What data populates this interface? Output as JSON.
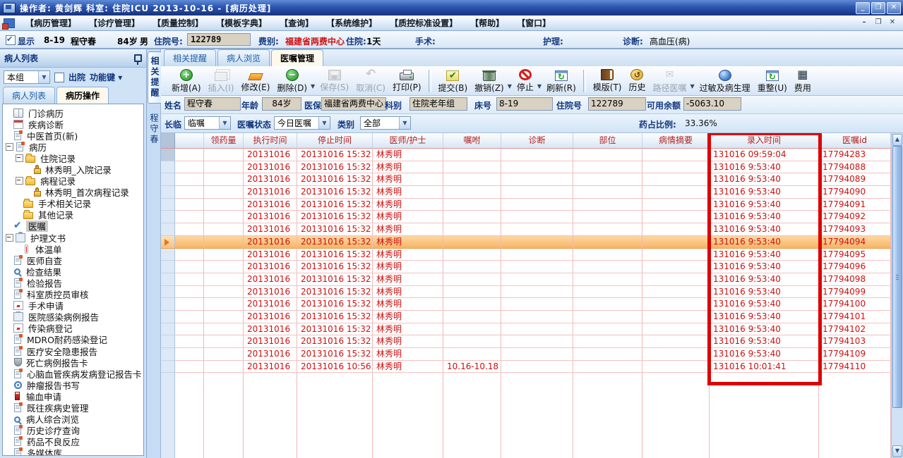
{
  "window": {
    "title": "操作者: 黄剑辉   科室: 住院ICU   2013-10-16 - [病历处理]",
    "buttons": {
      "minimize": "_",
      "restore": "❐",
      "close": "✕"
    }
  },
  "menu": {
    "items": [
      {
        "id": "record-management",
        "label": "【病历管理】"
      },
      {
        "id": "diagnosis-treatment",
        "label": "【诊疗管理】"
      },
      {
        "id": "quality-control",
        "label": "【质量控制】"
      },
      {
        "id": "template-dictionary",
        "label": "【模板字典】"
      },
      {
        "id": "query",
        "label": "【查询】"
      },
      {
        "id": "system-maintenance",
        "label": "【系统维护】"
      },
      {
        "id": "qc-standard-settings",
        "label": "【质控标准设置】"
      },
      {
        "id": "help",
        "label": "【帮助】"
      },
      {
        "id": "window",
        "label": "【窗口】"
      }
    ]
  },
  "infobar": {
    "show_label": "显示",
    "bed": "8-19",
    "name": "程守春",
    "age": "84岁",
    "sex": "男",
    "adm_label": "住院号:",
    "adm_no": "122789",
    "fee_label": "费别:",
    "fee_value": "福建省两费中心",
    "stay_label": "住院:",
    "stay_value": "1天",
    "surgery_label": "手术:",
    "nursing_label": "护理:",
    "diag_label": "诊断:",
    "diag_value": "高血压(病)"
  },
  "sidebar": {
    "header": "病人列表",
    "group_value": "本组",
    "discharge_label": "出院",
    "fnkey_label": "功能键",
    "tabs": [
      {
        "id": "patient-list",
        "label": "病人列表",
        "active": false
      },
      {
        "id": "record-operations",
        "label": "病历操作",
        "active": true
      }
    ],
    "tree": [
      {
        "id": "outpatient-record",
        "label": "门诊病历",
        "icon": "book",
        "level": 0
      },
      {
        "id": "disease-diagnosis",
        "label": "疾病诊断",
        "icon": "cal",
        "level": 0
      },
      {
        "id": "tcm-homepage-new",
        "label": "中医首页(新)",
        "icon": "doc",
        "level": 0
      },
      {
        "id": "medical-record",
        "label": "病历",
        "icon": "doc",
        "level": 0,
        "expander": true
      },
      {
        "id": "inpatient-records",
        "label": "住院记录",
        "icon": "folder",
        "level": 1,
        "expander": true
      },
      {
        "id": "admission-record-linxiuming",
        "label": "林秀明_入院记录",
        "icon": "lock",
        "level": 2
      },
      {
        "id": "progress-records",
        "label": "病程记录",
        "icon": "folder",
        "level": 1,
        "expander": true
      },
      {
        "id": "first-progress-note-linxiuming",
        "label": "林秀明_首次病程记录",
        "icon": "lock",
        "level": 2
      },
      {
        "id": "surgery-related-records",
        "label": "手术相关记录",
        "icon": "folder",
        "level": 1
      },
      {
        "id": "other-records",
        "label": "其他记录",
        "icon": "folder",
        "level": 1
      },
      {
        "id": "medical-orders",
        "label": "医嘱",
        "icon": "check",
        "level": 0,
        "selected": true
      },
      {
        "id": "nursing-documents",
        "label": "护理文书",
        "icon": "clip",
        "level": 0,
        "expander": true
      },
      {
        "id": "temperature-chart",
        "label": "体温单",
        "icon": "therm",
        "level": 1
      },
      {
        "id": "physician-self-check",
        "label": "医师自查",
        "icon": "doc",
        "level": 0
      },
      {
        "id": "exam-results",
        "label": "检查结果",
        "icon": "mag",
        "level": 0
      },
      {
        "id": "lab-reports",
        "label": "检验报告",
        "icon": "doc",
        "level": 0
      },
      {
        "id": "dept-qc-review",
        "label": "科室质控员审核",
        "icon": "doc",
        "level": 0
      },
      {
        "id": "surgery-application",
        "label": "手术申请",
        "icon": "chart",
        "level": 0
      },
      {
        "id": "hospital-infection-report",
        "label": "医院感染病例报告",
        "icon": "clip",
        "level": 0
      },
      {
        "id": "infectious-disease-registry",
        "label": "传染病登记",
        "icon": "chart",
        "level": 0
      },
      {
        "id": "mdro-infection-registry",
        "label": "MDRO耐药感染登记",
        "icon": "doc",
        "level": 0
      },
      {
        "id": "medical-safety-hazard-report",
        "label": "医疗安全隐患报告",
        "icon": "doc",
        "level": 0
      },
      {
        "id": "death-case-report-card",
        "label": "死亡病例报告卡",
        "icon": "shield",
        "level": 0
      },
      {
        "id": "cardiovascular-registry-card",
        "label": "心脑血管疾病发病登记报告卡",
        "icon": "doc",
        "level": 0
      },
      {
        "id": "tumor-report-writing",
        "label": "肿瘤报告书写",
        "icon": "target",
        "level": 0
      },
      {
        "id": "blood-transfusion-application",
        "label": "输血申请",
        "icon": "blood",
        "level": 0
      },
      {
        "id": "past-disease-history",
        "label": "既往疾病史管理",
        "icon": "doc",
        "level": 0
      },
      {
        "id": "patient-comprehensive-view",
        "label": "病人综合浏览",
        "icon": "mag",
        "level": 0
      },
      {
        "id": "history-diagnosis-query",
        "label": "历史诊疗查询",
        "icon": "doc",
        "level": 0
      },
      {
        "id": "adverse-drug-reaction",
        "label": "药品不良反应",
        "icon": "doc",
        "level": 0
      },
      {
        "id": "multimedia-library",
        "label": "多媒体库",
        "icon": "doc",
        "level": 0
      }
    ]
  },
  "vertical_tabs": [
    {
      "id": "related-reminders",
      "label": "相关提醒",
      "active": true
    },
    {
      "id": "patient-name",
      "label": "程守春",
      "active": false
    }
  ],
  "main": {
    "tabs": [
      {
        "id": "related-reminders",
        "label": "相关提醒",
        "active": false
      },
      {
        "id": "patient-browse",
        "label": "病人浏览",
        "active": false
      },
      {
        "id": "orders-management",
        "label": "医嘱管理",
        "active": true
      }
    ]
  },
  "toolbar": {
    "buttons": [
      {
        "id": "add",
        "label": "新增(A)",
        "icon": "add",
        "enabled": true
      },
      {
        "id": "insert",
        "label": "插入(I)",
        "icon": "insert",
        "enabled": false
      },
      {
        "id": "modify",
        "label": "修改(E)",
        "icon": "edit",
        "enabled": true
      },
      {
        "id": "delete",
        "label": "删除(D)",
        "icon": "remove",
        "enabled": true,
        "dropdown": true
      },
      {
        "id": "save",
        "label": "保存(S)",
        "icon": "save",
        "enabled": false
      },
      {
        "id": "cancel",
        "label": "取消(C)",
        "icon": "undo",
        "enabled": false
      },
      {
        "id": "print",
        "label": "打印(P)",
        "icon": "print",
        "enabled": true
      },
      {
        "sep": true
      },
      {
        "id": "submit",
        "label": "提交(B)",
        "icon": "submit",
        "enabled": true
      },
      {
        "id": "revoke",
        "label": "撤销(Z)",
        "icon": "trash",
        "enabled": true,
        "dropdown": true
      },
      {
        "id": "stop",
        "label": "停止",
        "icon": "stop",
        "enabled": true,
        "dropdown": true
      },
      {
        "id": "refresh",
        "label": "刷新(R)",
        "icon": "window",
        "enabled": true
      },
      {
        "sep": true
      },
      {
        "id": "template",
        "label": "模版(T)",
        "icon": "book",
        "enabled": true
      },
      {
        "id": "history",
        "label": "历史",
        "icon": "history",
        "enabled": true
      },
      {
        "id": "path-orders",
        "label": "路径医嘱",
        "icon": "path",
        "enabled": false,
        "dropdown": true
      },
      {
        "id": "allergy-pathophysiology",
        "label": "过敏及病生理",
        "icon": "allergy",
        "enabled": true
      },
      {
        "id": "rearrange",
        "label": "重整(U)",
        "icon": "window",
        "enabled": true
      },
      {
        "id": "fee",
        "label": "费用",
        "icon": "fee",
        "enabled": true
      }
    ]
  },
  "fields": {
    "name": {
      "label": "姓名",
      "value": "程守春"
    },
    "age": {
      "label": "年龄",
      "value": "84岁"
    },
    "insure": {
      "label": "医保",
      "value": "福建省两费中心"
    },
    "dept": {
      "label": "科别",
      "value": "住院老年组"
    },
    "bed": {
      "label": "床号",
      "value": "8-19"
    },
    "adm_no": {
      "label": "住院号",
      "value": "122789"
    },
    "balance": {
      "label": "可用余额",
      "value": "-5063.10"
    }
  },
  "filters": {
    "changlin_label": "长临",
    "changlin_value": "临嘱",
    "status_label": "医嘱状态",
    "status_value": "今日医嘱",
    "type_label": "类别",
    "type_value": "全部",
    "ratio_label": "药占比例:",
    "ratio_value": "33.36%"
  },
  "table": {
    "columns": [
      {
        "id": "indicator",
        "label": ""
      },
      {
        "id": "blank",
        "label": ""
      },
      {
        "id": "dispense-qty",
        "label": "领药量"
      },
      {
        "id": "exec-time",
        "label": "执行时间"
      },
      {
        "id": "stop-time",
        "label": "停止时间"
      },
      {
        "id": "doctor-nurse",
        "label": "医师/护士"
      },
      {
        "id": "instruction",
        "label": "嘱咐"
      },
      {
        "id": "diagnosis",
        "label": "诊断"
      },
      {
        "id": "body-part",
        "label": "部位"
      },
      {
        "id": "condition-summary",
        "label": "病情摘要"
      },
      {
        "id": "entry-time",
        "label": "录入时间"
      },
      {
        "id": "order-id",
        "label": "医嘱id"
      }
    ],
    "selected_row_index": 7,
    "rows": [
      {
        "exec": "20131016",
        "stop": "20131016 15:32:00",
        "doctor": "林秀明",
        "note": "",
        "entry": "131016 09:59:04",
        "id": "17794283"
      },
      {
        "exec": "20131016",
        "stop": "20131016 15:32:00",
        "doctor": "林秀明",
        "note": "",
        "entry": "131016 9:53:40",
        "id": "17794088"
      },
      {
        "exec": "20131016",
        "stop": "20131016 15:32:00",
        "doctor": "林秀明",
        "note": "",
        "entry": "131016 9:53:40",
        "id": "17794089"
      },
      {
        "exec": "20131016",
        "stop": "20131016 15:32:00",
        "doctor": "林秀明",
        "note": "",
        "entry": "131016 9:53:40",
        "id": "17794090"
      },
      {
        "exec": "20131016",
        "stop": "20131016 15:32:00",
        "doctor": "林秀明",
        "note": "",
        "entry": "131016 9:53:40",
        "id": "17794091"
      },
      {
        "exec": "20131016",
        "stop": "20131016 15:32:00",
        "doctor": "林秀明",
        "note": "",
        "entry": "131016 9:53:40",
        "id": "17794092"
      },
      {
        "exec": "20131016",
        "stop": "20131016 15:32:00",
        "doctor": "林秀明",
        "note": "",
        "entry": "131016 9:53:40",
        "id": "17794093"
      },
      {
        "exec": "20131016",
        "stop": "20131016 15:32:00",
        "doctor": "林秀明",
        "note": "",
        "entry": "131016 9:53:40",
        "id": "17794094"
      },
      {
        "exec": "20131016",
        "stop": "20131016 15:32:00",
        "doctor": "林秀明",
        "note": "",
        "entry": "131016 9:53:40",
        "id": "17794095"
      },
      {
        "exec": "20131016",
        "stop": "20131016 15:32:00",
        "doctor": "林秀明",
        "note": "",
        "entry": "131016 9:53:40",
        "id": "17794096"
      },
      {
        "exec": "20131016",
        "stop": "20131016 15:32:00",
        "doctor": "林秀明",
        "note": "",
        "entry": "131016 9:53:40",
        "id": "17794098"
      },
      {
        "exec": "20131016",
        "stop": "20131016 15:32:00",
        "doctor": "林秀明",
        "note": "",
        "entry": "131016 9:53:40",
        "id": "17794099"
      },
      {
        "exec": "20131016",
        "stop": "20131016 15:32:00",
        "doctor": "林秀明",
        "note": "",
        "entry": "131016 9:53:40",
        "id": "17794100"
      },
      {
        "exec": "20131016",
        "stop": "20131016 15:32:00",
        "doctor": "林秀明",
        "note": "",
        "entry": "131016 9:53:40",
        "id": "17794101"
      },
      {
        "exec": "20131016",
        "stop": "20131016 15:32:00",
        "doctor": "林秀明",
        "note": "",
        "entry": "131016 9:53:40",
        "id": "17794102"
      },
      {
        "exec": "20131016",
        "stop": "20131016 15:32:00",
        "doctor": "林秀明",
        "note": "",
        "entry": "131016 9:53:40",
        "id": "17794103"
      },
      {
        "exec": "20131016",
        "stop": "20131016 15:32:00",
        "doctor": "林秀明",
        "note": "",
        "entry": "131016 9:53:40",
        "id": "17794109"
      },
      {
        "exec": "20131016",
        "stop": "20131016 10:56:00",
        "doctor": "林秀明",
        "note": "10.16-10.18",
        "entry": "131016 10:01:41",
        "id": "17794110"
      }
    ]
  },
  "annotation": {
    "color": "#dd0000",
    "target": "entry-time-column"
  }
}
